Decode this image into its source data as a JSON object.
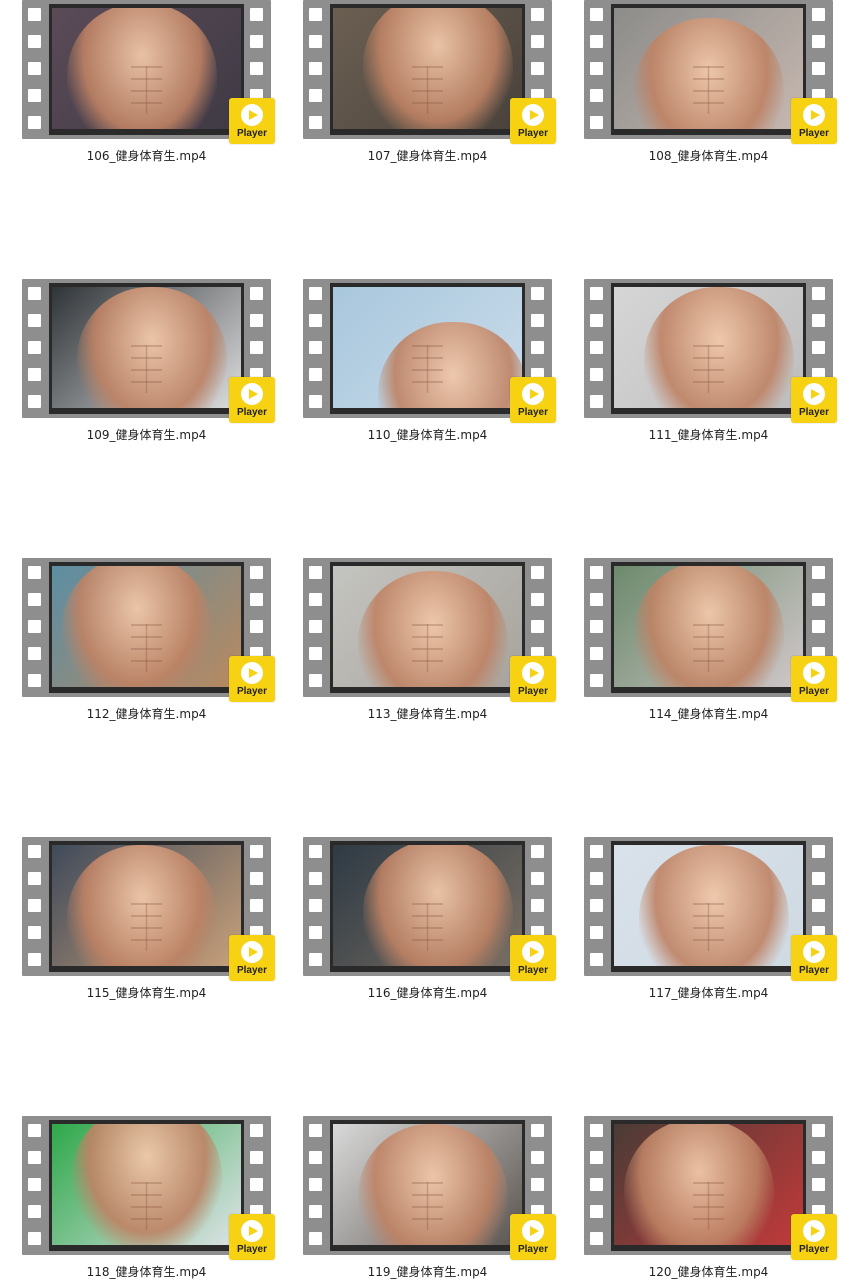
{
  "player_label": "Player",
  "colors": {
    "film": "#8e8e8e",
    "frame": "#2a2a2a",
    "player_badge": "#f7d213",
    "background": "#ffffff"
  },
  "icons": {
    "badge": "play-icon"
  },
  "videos": [
    {
      "filename": "106_健身体育生.mp4",
      "bg": [
        "#5a4b57",
        "#3f3a45"
      ]
    },
    {
      "filename": "107_健身体育生.mp4",
      "bg": [
        "#6b5f52",
        "#49423b"
      ]
    },
    {
      "filename": "108_健身体育生.mp4",
      "bg": [
        "#8c8c8a",
        "#c7b8b0"
      ]
    },
    {
      "filename": "109_健身体育生.mp4",
      "bg": [
        "#2f3438",
        "#dedede"
      ]
    },
    {
      "filename": "110_健身体育生.mp4",
      "bg": [
        "#a9c7dc",
        "#c9dceb"
      ]
    },
    {
      "filename": "111_健身体育生.mp4",
      "bg": [
        "#d6d6d6",
        "#bdbdbd"
      ]
    },
    {
      "filename": "112_健身体育生.mp4",
      "bg": [
        "#5c8ea3",
        "#b9895f"
      ]
    },
    {
      "filename": "113_健身体育生.mp4",
      "bg": [
        "#c4c4c0",
        "#a7a39c"
      ]
    },
    {
      "filename": "114_健身体育生.mp4",
      "bg": [
        "#6c8a6c",
        "#d0c7c9"
      ]
    },
    {
      "filename": "115_健身体育生.mp4",
      "bg": [
        "#3f4a5a",
        "#c9a17a"
      ]
    },
    {
      "filename": "116_健身体育生.mp4",
      "bg": [
        "#2e3a44",
        "#7a6f63"
      ]
    },
    {
      "filename": "117_健身体育生.mp4",
      "bg": [
        "#d9e2ea",
        "#cfd9e2"
      ]
    },
    {
      "filename": "118_健身体育生.mp4",
      "bg": [
        "#2ea84a",
        "#dfe3e8"
      ]
    },
    {
      "filename": "119_健身体育生.mp4",
      "bg": [
        "#d9d9d9",
        "#5a544f"
      ]
    },
    {
      "filename": "120_健身体育生.mp4",
      "bg": [
        "#4a3b36",
        "#c23a3a"
      ]
    }
  ]
}
